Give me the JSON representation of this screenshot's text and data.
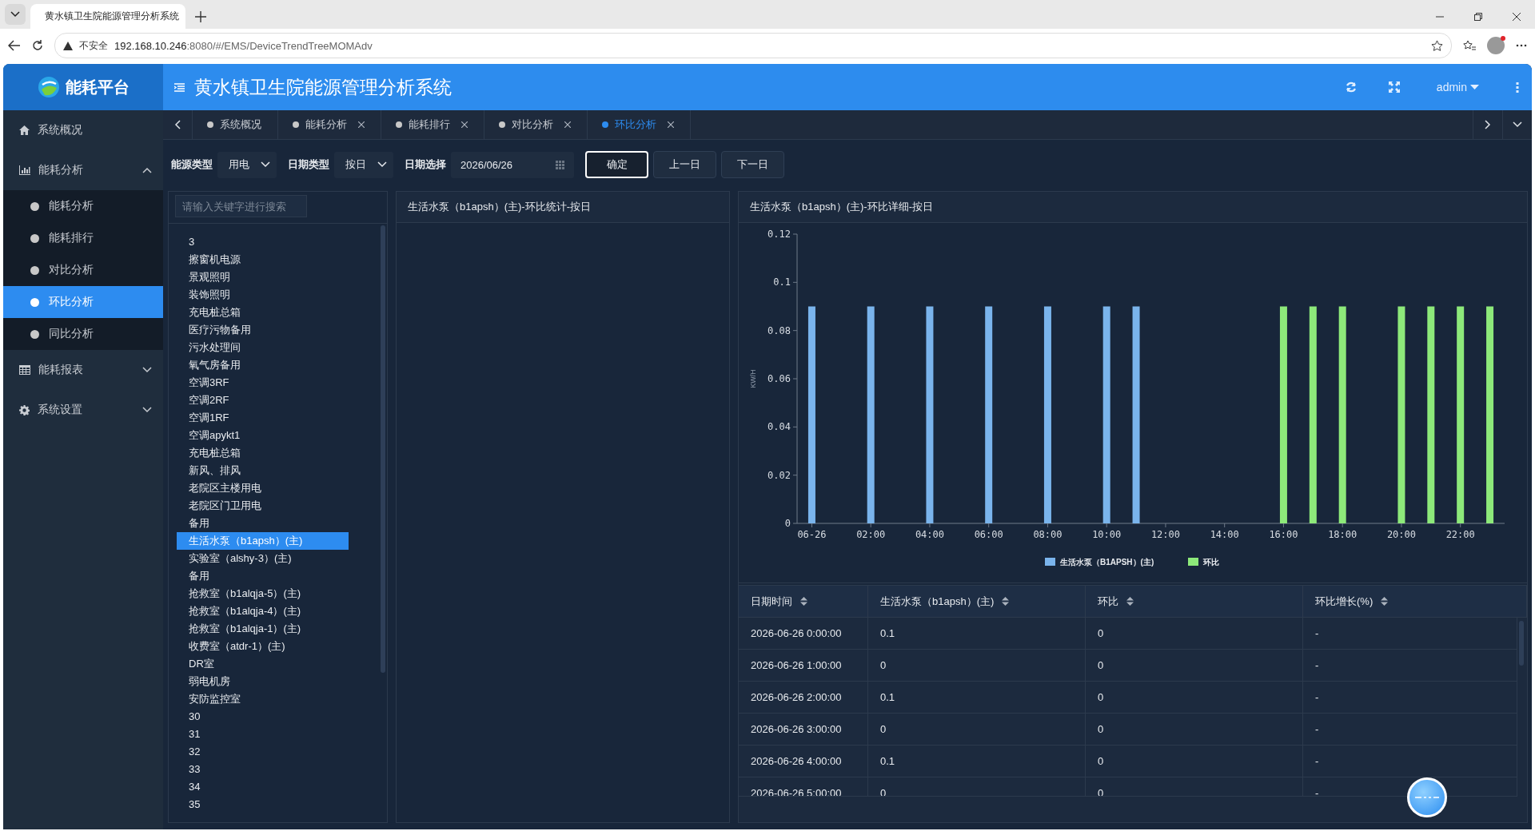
{
  "browser": {
    "tab_title": "黄水镇卫生院能源管理分析系统",
    "security_label": "不安全",
    "url_host": "192.168.10.246",
    "url_rest": ":8080/#/EMS/DeviceTrendTreeMOMAdv"
  },
  "app": {
    "logo_text": "能耗平台",
    "title": "黄水镇卫生院能源管理分析系统",
    "user": "admin"
  },
  "sidebar": [
    {
      "label": "系统概况",
      "kind": "home",
      "selected": false
    },
    {
      "label": "能耗分析",
      "kind": "chart",
      "selected": false,
      "expanded": true,
      "children": [
        {
          "label": "能耗分析",
          "selected": false
        },
        {
          "label": "能耗排行",
          "selected": false
        },
        {
          "label": "对比分析",
          "selected": false
        },
        {
          "label": "环比分析",
          "selected": true
        },
        {
          "label": "同比分析",
          "selected": false
        }
      ]
    },
    {
      "label": "能耗报表",
      "kind": "table",
      "selected": false,
      "expanded": false
    },
    {
      "label": "系统设置",
      "kind": "gear",
      "selected": false,
      "expanded": false
    }
  ],
  "tabs": [
    {
      "label": "系统概况",
      "closable": false,
      "selected": false
    },
    {
      "label": "能耗分析",
      "closable": true,
      "selected": false
    },
    {
      "label": "能耗排行",
      "closable": true,
      "selected": false
    },
    {
      "label": "对比分析",
      "closable": true,
      "selected": false
    },
    {
      "label": "环比分析",
      "closable": true,
      "selected": true
    }
  ],
  "filters": {
    "energy_type": {
      "label": "能源类型",
      "value": "用电"
    },
    "date_type": {
      "label": "日期类型",
      "value": "按日"
    },
    "date": {
      "label": "日期选择",
      "value": "2026/06/26"
    },
    "buttons": [
      {
        "label": "确定",
        "selected": true
      },
      {
        "label": "上一日",
        "selected": false
      },
      {
        "label": "下一日",
        "selected": false
      }
    ]
  },
  "tree": {
    "placeholder": "请输入关键字进行搜索",
    "items": [
      {
        "label": "3",
        "selected": false
      },
      {
        "label": "擦窗机电源",
        "selected": false
      },
      {
        "label": "景观照明",
        "selected": false
      },
      {
        "label": "装饰照明",
        "selected": false
      },
      {
        "label": "充电桩总箱",
        "selected": false
      },
      {
        "label": "医疗污物备用",
        "selected": false
      },
      {
        "label": "污水处理间",
        "selected": false
      },
      {
        "label": "氧气房备用",
        "selected": false
      },
      {
        "label": "空调3RF",
        "selected": false
      },
      {
        "label": "空调2RF",
        "selected": false
      },
      {
        "label": "空调1RF",
        "selected": false
      },
      {
        "label": "空调apykt1",
        "selected": false
      },
      {
        "label": "充电桩总箱",
        "selected": false
      },
      {
        "label": "新风、排风",
        "selected": false
      },
      {
        "label": "老院区主楼用电",
        "selected": false
      },
      {
        "label": "老院区门卫用电",
        "selected": false
      },
      {
        "label": "备用",
        "selected": false
      },
      {
        "label": "生活水泵（b1apsh）(主)",
        "selected": true
      },
      {
        "label": "实验室（alshy-3）(主)",
        "selected": false
      },
      {
        "label": "备用",
        "selected": false
      },
      {
        "label": "抢救室（b1alqja-5）(主)",
        "selected": false
      },
      {
        "label": "抢救室（b1alqja-4）(主)",
        "selected": false
      },
      {
        "label": "抢救室（b1alqja-1）(主)",
        "selected": false
      },
      {
        "label": "收费室（atdr-1）(主)",
        "selected": false
      },
      {
        "label": "DR室",
        "selected": false
      },
      {
        "label": "弱电机房",
        "selected": false
      },
      {
        "label": "安防监控室",
        "selected": false
      },
      {
        "label": "30",
        "selected": false
      },
      {
        "label": "31",
        "selected": false
      },
      {
        "label": "32",
        "selected": false
      },
      {
        "label": "33",
        "selected": false
      },
      {
        "label": "34",
        "selected": false
      },
      {
        "label": "35",
        "selected": false
      }
    ]
  },
  "stats_panel": {
    "title": "生活水泵（b1apsh）(主)-环比统计-按日"
  },
  "detail_panel": {
    "title": "生活水泵（b1apsh）(主)-环比详细-按日",
    "chart_data": {
      "type": "bar",
      "ylabel": "KW/H",
      "x": [
        0,
        1,
        2,
        3,
        4,
        5,
        6,
        7,
        8,
        9,
        10,
        11,
        12,
        13,
        14,
        15,
        16,
        17,
        18,
        19,
        20,
        21,
        22,
        23
      ],
      "series": [
        {
          "name": "生活水泵（B1APSH）(主)",
          "color": "#7ab4ec",
          "values": [
            0.09,
            0,
            0.09,
            0,
            0.09,
            0,
            0.09,
            0,
            0.09,
            0,
            0.09,
            0.09,
            0,
            0,
            0,
            0,
            0,
            0,
            0,
            0,
            0,
            0,
            0,
            0
          ]
        },
        {
          "name": "环比",
          "color": "#8de97a",
          "values": [
            0,
            0,
            0,
            0,
            0,
            0,
            0,
            0,
            0,
            0,
            0,
            0,
            0,
            0,
            0,
            0,
            0.09,
            0.09,
            0.09,
            0,
            0.09,
            0.09,
            0.09,
            0.09
          ]
        }
      ],
      "xlim": [
        -0.5,
        23.5
      ],
      "ylim": [
        0,
        0.12
      ],
      "legend": "bottom",
      "yticks": [
        0,
        0.02,
        0.04,
        0.06,
        0.08,
        {
          "value": 0.1,
          "label": "0.1"
        },
        0.12
      ],
      "xticks": [
        {
          "value": 0,
          "label": "06-26"
        },
        {
          "value": 2,
          "label": "02:00"
        },
        {
          "value": 4,
          "label": "04:00"
        },
        {
          "value": 6,
          "label": "06:00"
        },
        {
          "value": 8,
          "label": "08:00"
        },
        {
          "value": 10,
          "label": "10:00"
        },
        {
          "value": 12,
          "label": "12:00"
        },
        {
          "value": 14,
          "label": "14:00"
        },
        {
          "value": 16,
          "label": "16:00"
        },
        {
          "value": 18,
          "label": "18:00"
        },
        {
          "value": 20,
          "label": "20:00"
        },
        {
          "value": 22,
          "label": "22:00"
        }
      ]
    },
    "table": {
      "columns": [
        "日期时间",
        "生活水泵（b1apsh）(主)",
        "环比",
        "环比增长(%)"
      ],
      "rows": [
        [
          "2026-06-26 0:00:00",
          "0.1",
          "0",
          "-"
        ],
        [
          "2026-06-26 1:00:00",
          "0",
          "0",
          "-"
        ],
        [
          "2026-06-26 2:00:00",
          "0.1",
          "0",
          "-"
        ],
        [
          "2026-06-26 3:00:00",
          "0",
          "0",
          "-"
        ],
        [
          "2026-06-26 4:00:00",
          "0.1",
          "0",
          "-"
        ],
        [
          "2026-06-26 5:00:00",
          "0",
          "0",
          "-"
        ]
      ]
    }
  }
}
